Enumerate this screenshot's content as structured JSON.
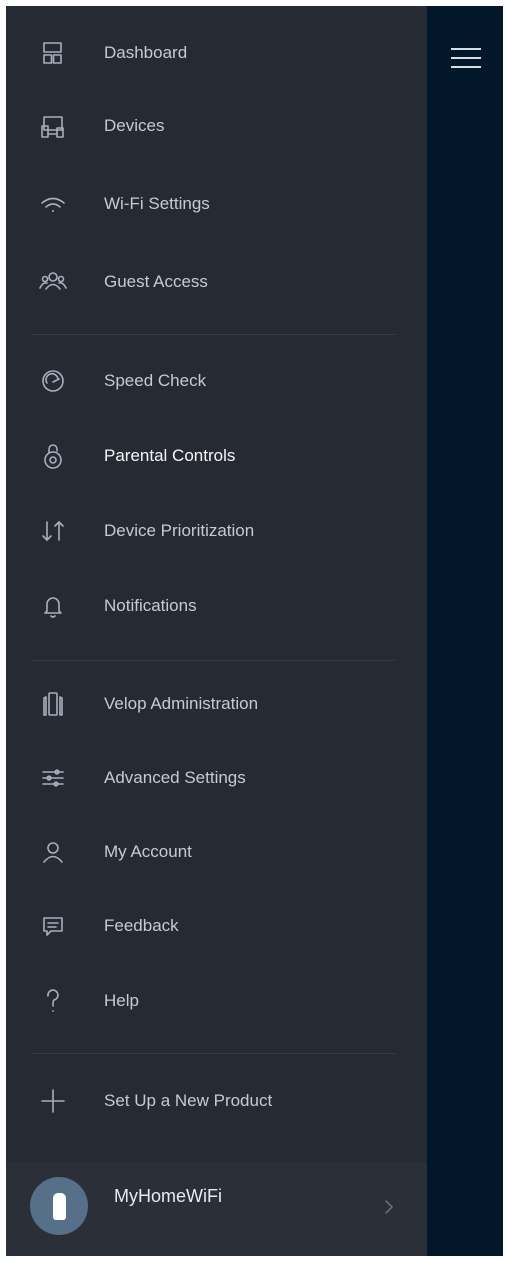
{
  "drawer": {
    "sections": [
      {
        "items": [
          {
            "id": "dashboard",
            "label": "Dashboard",
            "icon": "dashboard-icon"
          },
          {
            "id": "devices",
            "label": "Devices",
            "icon": "devices-icon"
          },
          {
            "id": "wifi-settings",
            "label": "Wi-Fi Settings",
            "icon": "wifi-icon"
          },
          {
            "id": "guest-access",
            "label": "Guest Access",
            "icon": "guest-access-icon"
          }
        ]
      },
      {
        "items": [
          {
            "id": "speed-check",
            "label": "Speed Check",
            "icon": "speedometer-icon"
          },
          {
            "id": "parental-controls",
            "label": "Parental Controls",
            "icon": "padlock-icon",
            "active": true
          },
          {
            "id": "device-prioritization",
            "label": "Device Prioritization",
            "icon": "up-down-arrows-icon"
          },
          {
            "id": "notifications",
            "label": "Notifications",
            "icon": "bell-icon"
          }
        ]
      },
      {
        "items": [
          {
            "id": "velop-administration",
            "label": "Velop Administration",
            "icon": "velop-node-icon"
          },
          {
            "id": "advanced-settings",
            "label": "Advanced Settings",
            "icon": "sliders-icon"
          },
          {
            "id": "my-account",
            "label": "My Account",
            "icon": "user-icon"
          },
          {
            "id": "feedback",
            "label": "Feedback",
            "icon": "chat-bubble-icon"
          },
          {
            "id": "help",
            "label": "Help",
            "icon": "question-mark-icon"
          }
        ]
      },
      {
        "items": [
          {
            "id": "setup-new-product",
            "label": "Set Up a New Product",
            "icon": "plus-icon"
          }
        ]
      }
    ],
    "footer": {
      "network_name": "MyHomeWiFi",
      "avatar_icon": "velop-node-icon",
      "chevron_icon": "chevron-right-icon"
    }
  },
  "header": {
    "menu_icon": "hamburger-menu-icon"
  },
  "colors": {
    "drawer_bg": "#262a33",
    "panel_bg": "#03172a",
    "text": "#c6cbd2",
    "active_text": "#f4f6f8",
    "icon": "#a9b0ba"
  }
}
